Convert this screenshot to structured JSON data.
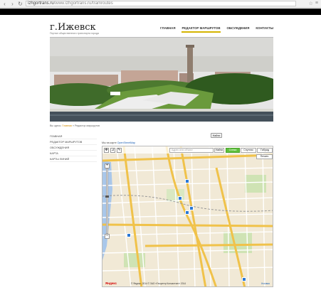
{
  "browser": {
    "back_icon": "arrow-left-icon",
    "forward_icon": "arrow-right-icon",
    "reload_icon": "reload-icon",
    "url_host": "izhgortrans.ru",
    "url_path": "/www.izhgortrans.ru/tramroutes",
    "star_icon": "star-icon",
    "menu_icon": "wrench-icon"
  },
  "header": {
    "logo": "г.Ижевск",
    "tagline": "Портал общественного транспорта города"
  },
  "nav": {
    "items": [
      {
        "label": "ГЛАВНАЯ",
        "active": false
      },
      {
        "label": "РЕДАКТОР МАРШРУТОВ",
        "active": true
      },
      {
        "label": "ОБСУЖДЕНИЯ",
        "active": false
      },
      {
        "label": "КОНТАКТЫ",
        "active": false
      }
    ]
  },
  "breadcrumb": {
    "prefix": "Вы здесь:",
    "home": "Главная",
    "sep": "»",
    "current": "Редактор маршрутов"
  },
  "sidebar": {
    "items": [
      "ГЛАВНАЯ",
      "РЕДАКТОР МАРШРУТОВ",
      "ОБСУЖДЕНИЯ",
      "КАРТА",
      "КАРТЫ ЛИНИЙ"
    ]
  },
  "map": {
    "search_button": "Найти",
    "caption_prefix": "Мы на карте",
    "caption_link": "OpenStreetMap",
    "search_placeholder": "Адрес или объект",
    "find_label": "Найти",
    "types": [
      {
        "label": "Схема",
        "active": true
      },
      {
        "label": "Спутник",
        "active": false
      },
      {
        "label": "Гибрид",
        "active": false
      }
    ],
    "print_label": "Печать",
    "zoom_in": "+",
    "zoom_out": "−",
    "zoom_level": 0.42,
    "brand": "Яндекс",
    "copyright": "© Яндекс, 2014   © ЗАО «Геоцентр Консалтинг» 2014",
    "terms": "Условия"
  },
  "colors": {
    "accent": "#d4b400",
    "map_bg": "#f1e9d6",
    "road_major": "#f0c24a",
    "road_minor": "#ffffff",
    "water": "#a9c7ea",
    "park": "#cfe3b4"
  }
}
